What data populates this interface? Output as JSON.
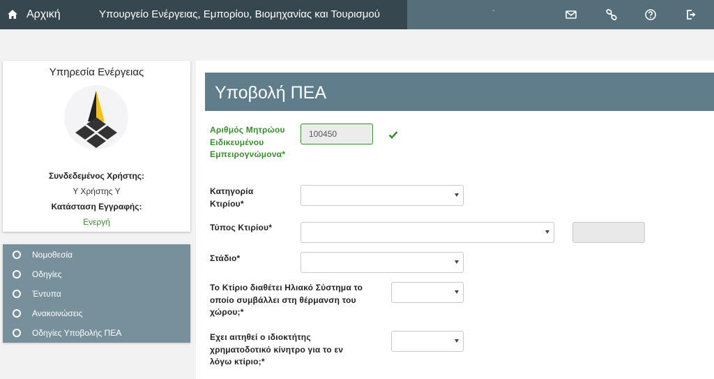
{
  "navbar": {
    "home_label": "Αρχική",
    "ministry_title": "Υπουργείο Ενέργειας, Εμπορίου, Βιομηχανίας και Τουρισμού",
    "dot": "-"
  },
  "profile": {
    "service_title": "Υπηρεσία Ενέργειας",
    "user_label": "Συνδεδεμένος Χρήστης:",
    "user_value": "Υ Χρήστης Υ",
    "status_label": "Κατάσταση Εγγραφής:",
    "status_value": "Ενεργή"
  },
  "sidebar": {
    "items": [
      {
        "label": "Νομοθεσία"
      },
      {
        "label": "Οδηγίες"
      },
      {
        "label": "Έντυπα"
      },
      {
        "label": "Ανακοινώσεις"
      },
      {
        "label": "Οδηγίες Υποβολής ΠΕΑ"
      }
    ]
  },
  "form": {
    "title": "Υποβολή ΠΕΑ",
    "registry_label": "Αριθμός Μητρώου Ειδικευμένου Εμπειρογνώμονα*",
    "registry_value": "100450",
    "category_label": "Κατηγορία Κτιρίου*",
    "category_value": "",
    "type_label": "Τύπος Κτιρίου*",
    "type_value": "",
    "stage_label": "Στάδιο*",
    "stage_value": "",
    "solar_label": "Το Κτίριο διαθέτει Ηλιακό Σύστημα το οποίο συμβάλλει στη θέρμανση του χώρου;*",
    "solar_value": "",
    "incentive_label": "Εχει αιτηθεί ο ιδιοκτήτης χρηματοδοτικό κίνητρο για το εν λόγω κτίριο;*",
    "incentive_value": ""
  },
  "colors": {
    "navbar_dark": "#37474f",
    "navbar": "#546e7a",
    "header": "#607d8b",
    "sidebar": "#78909c",
    "valid_green": "#3a8a2e"
  },
  "icons": {
    "home": "home-icon",
    "mail": "envelope-icon",
    "link": "link-icon",
    "help": "question-icon",
    "logout": "sign-out-icon",
    "check": "check-icon"
  }
}
